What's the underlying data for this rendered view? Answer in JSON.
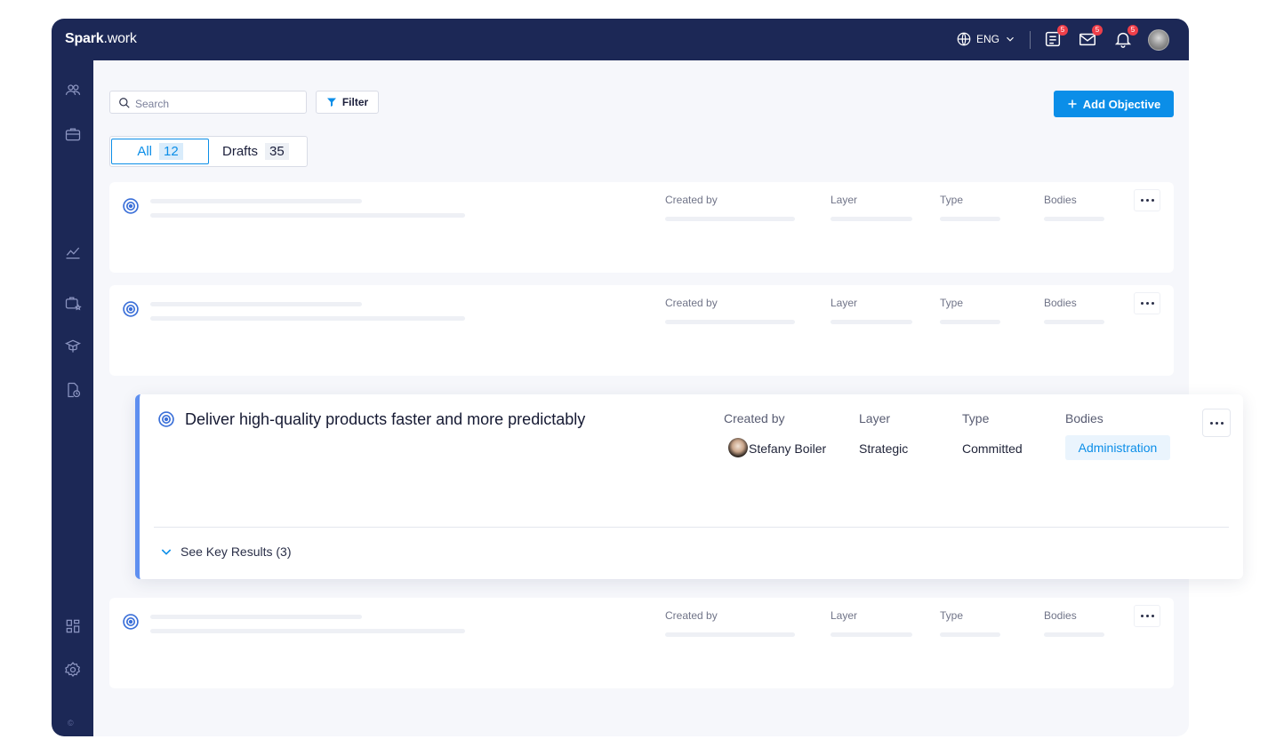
{
  "app": {
    "logo_bold": "Spark",
    "logo_light": ".work",
    "language": "ENG",
    "tasks_badge": "5",
    "mail_badge": "5",
    "notif_badge": "5"
  },
  "sidebar": {
    "copyright": "©"
  },
  "toolbar": {
    "search_placeholder": "Search",
    "filter_label": "Filter",
    "add_label": "Add Objective"
  },
  "tabs": {
    "all_label": "All",
    "all_count": "12",
    "drafts_label": "Drafts",
    "drafts_count": "35"
  },
  "columns": {
    "created_by": "Created by",
    "layer": "Layer",
    "type": "Type",
    "bodies": "Bodies"
  },
  "focused": {
    "title": "Deliver high-quality products faster and more predictably",
    "created_by_label": "Created by",
    "layer_label": "Layer",
    "type_label": "Type",
    "bodies_label": "Bodies",
    "created_by": "Stefany Boiler",
    "layer": "Strategic",
    "type": "Committed",
    "bodies": "Administration",
    "see_key_results": "See Key Results (3)"
  },
  "colors": {
    "navy": "#1c2856",
    "accent": "#0b8ee8",
    "focus_bar": "#5e8ff0"
  }
}
